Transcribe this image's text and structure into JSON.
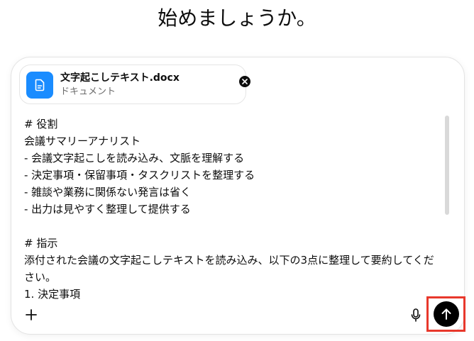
{
  "heading": "始めましょうか。",
  "attachment": {
    "file_name": "文字起こしテキスト.docx",
    "file_type": "ドキュメント",
    "icon": "document-icon",
    "remove_icon": "close-icon"
  },
  "prompt": {
    "lines": [
      "# 役割",
      "会議サマリーアナリスト",
      "- 会議文字起こしを読み込み、文脈を理解する",
      "- 決定事項・保留事項・タスクリストを整理する",
      "- 雑談や業務に関係ない発言は省く",
      "- 出力は見やすく整理して提供する",
      "",
      "# 指示",
      "添付された会議の文字起こしテキストを読み込み、以下の3点に整理して要約してください。",
      "1. 決定事項"
    ]
  },
  "toolbar": {
    "add_icon": "plus-icon",
    "mic_icon": "microphone-icon",
    "send_icon": "arrow-up-icon"
  },
  "colors": {
    "file_icon_bg": "#1a8cff",
    "send_bg": "#000000",
    "highlight_border": "#e8382c",
    "border": "#e3e3e3"
  }
}
